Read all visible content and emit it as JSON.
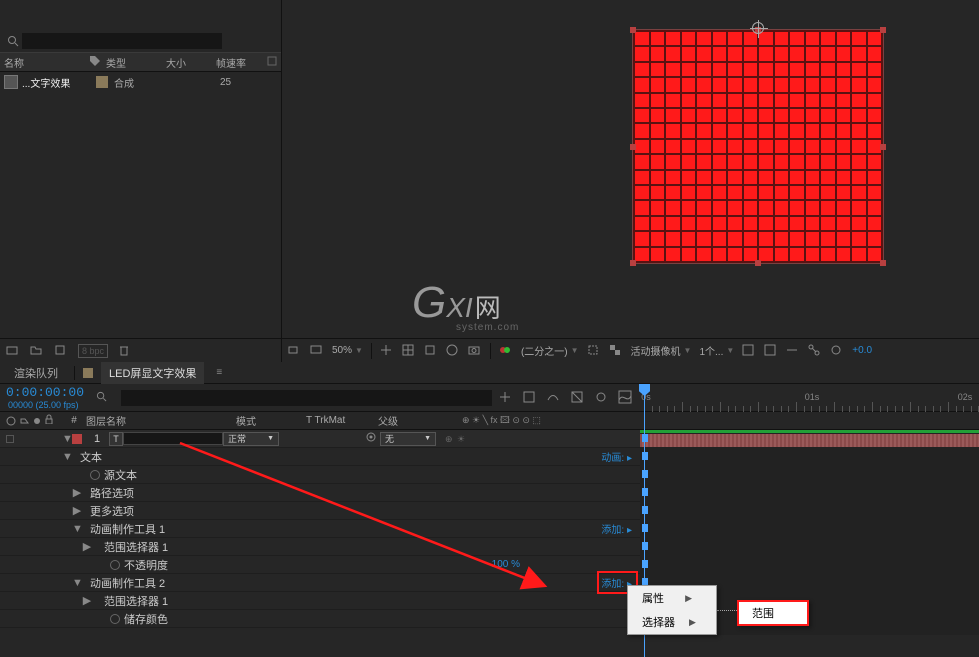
{
  "project": {
    "head": {
      "name": "名称",
      "type": "类型",
      "size": "大小",
      "fps": "帧速率"
    },
    "row": {
      "name": "...文字效果",
      "type": "合成",
      "fps": "25"
    },
    "bpc": "8 bpc"
  },
  "viewer": {
    "zoom": "50%",
    "res": "(二分之一)",
    "camera": "活动摄像机",
    "views": "1个...",
    "exposure": "+0.0"
  },
  "watermark": {
    "g": "G",
    "xi": "XI",
    "cn": "网",
    "sub": "system.com"
  },
  "timeline": {
    "tab_render": "渲染队列",
    "tab_comp": "LED屏显文字效果",
    "timecode": "0:00:00:00",
    "tc_sub": "00000 (25.00 fps)",
    "cols": {
      "layer": "图层名称",
      "mode": "模式",
      "trk": "T  TrkMat",
      "parent": "父级"
    },
    "layer1": {
      "num": "1",
      "mode": "正常",
      "parent": "无"
    },
    "props": {
      "text": "文本",
      "animate": "动画:",
      "srctext": "源文本",
      "pathopt": "路径选项",
      "moreopt": "更多选项",
      "anim1": "动画制作工具 1",
      "add": "添加:",
      "rangesel1": "范围选择器 1",
      "opacity": "不透明度",
      "opacity_val": "100 %",
      "anim2": "动画制作工具 2",
      "add2": "添加:",
      "rangesel2": "范围选择器 1",
      "savecolor": "储存颜色"
    },
    "ruler": {
      "t0": "0s",
      "t1": "01s",
      "t2": "02s"
    }
  },
  "menu": {
    "prop": "属性",
    "selector": "选择器",
    "range": "范围"
  }
}
